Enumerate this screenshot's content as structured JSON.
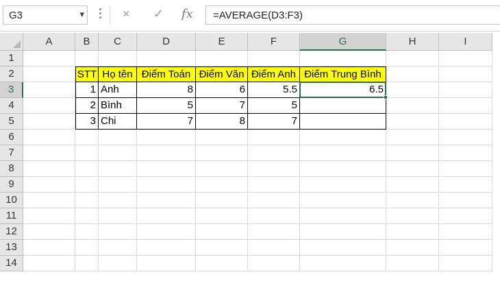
{
  "formula_bar": {
    "name_box": "G3",
    "formula": "=AVERAGE(D3:F3)",
    "cancel_icon": "×",
    "enter_icon": "✓",
    "fx_icon": "fx"
  },
  "columns": [
    "A",
    "B",
    "C",
    "D",
    "E",
    "F",
    "G",
    "H",
    "I"
  ],
  "active_column": "G",
  "rows": [
    "1",
    "2",
    "3",
    "4",
    "5",
    "6",
    "7",
    "8",
    "9",
    "10",
    "11",
    "12",
    "13",
    "14"
  ],
  "active_row": "3",
  "table": {
    "headers": [
      "STT",
      "Họ tên",
      "Điểm Toán",
      "Điểm Văn",
      "Điểm Anh",
      "Điểm Trung Bình"
    ],
    "rows": [
      [
        "1",
        "Anh",
        "8",
        "6",
        "5.5",
        "6.5"
      ],
      [
        "2",
        "Bình",
        "5",
        "7",
        "5",
        ""
      ],
      [
        "3",
        "Chi",
        "7",
        "8",
        "7",
        ""
      ]
    ]
  },
  "colors": {
    "header_fill": "#ffff00",
    "selection": "#217346",
    "accent": "#217346"
  }
}
